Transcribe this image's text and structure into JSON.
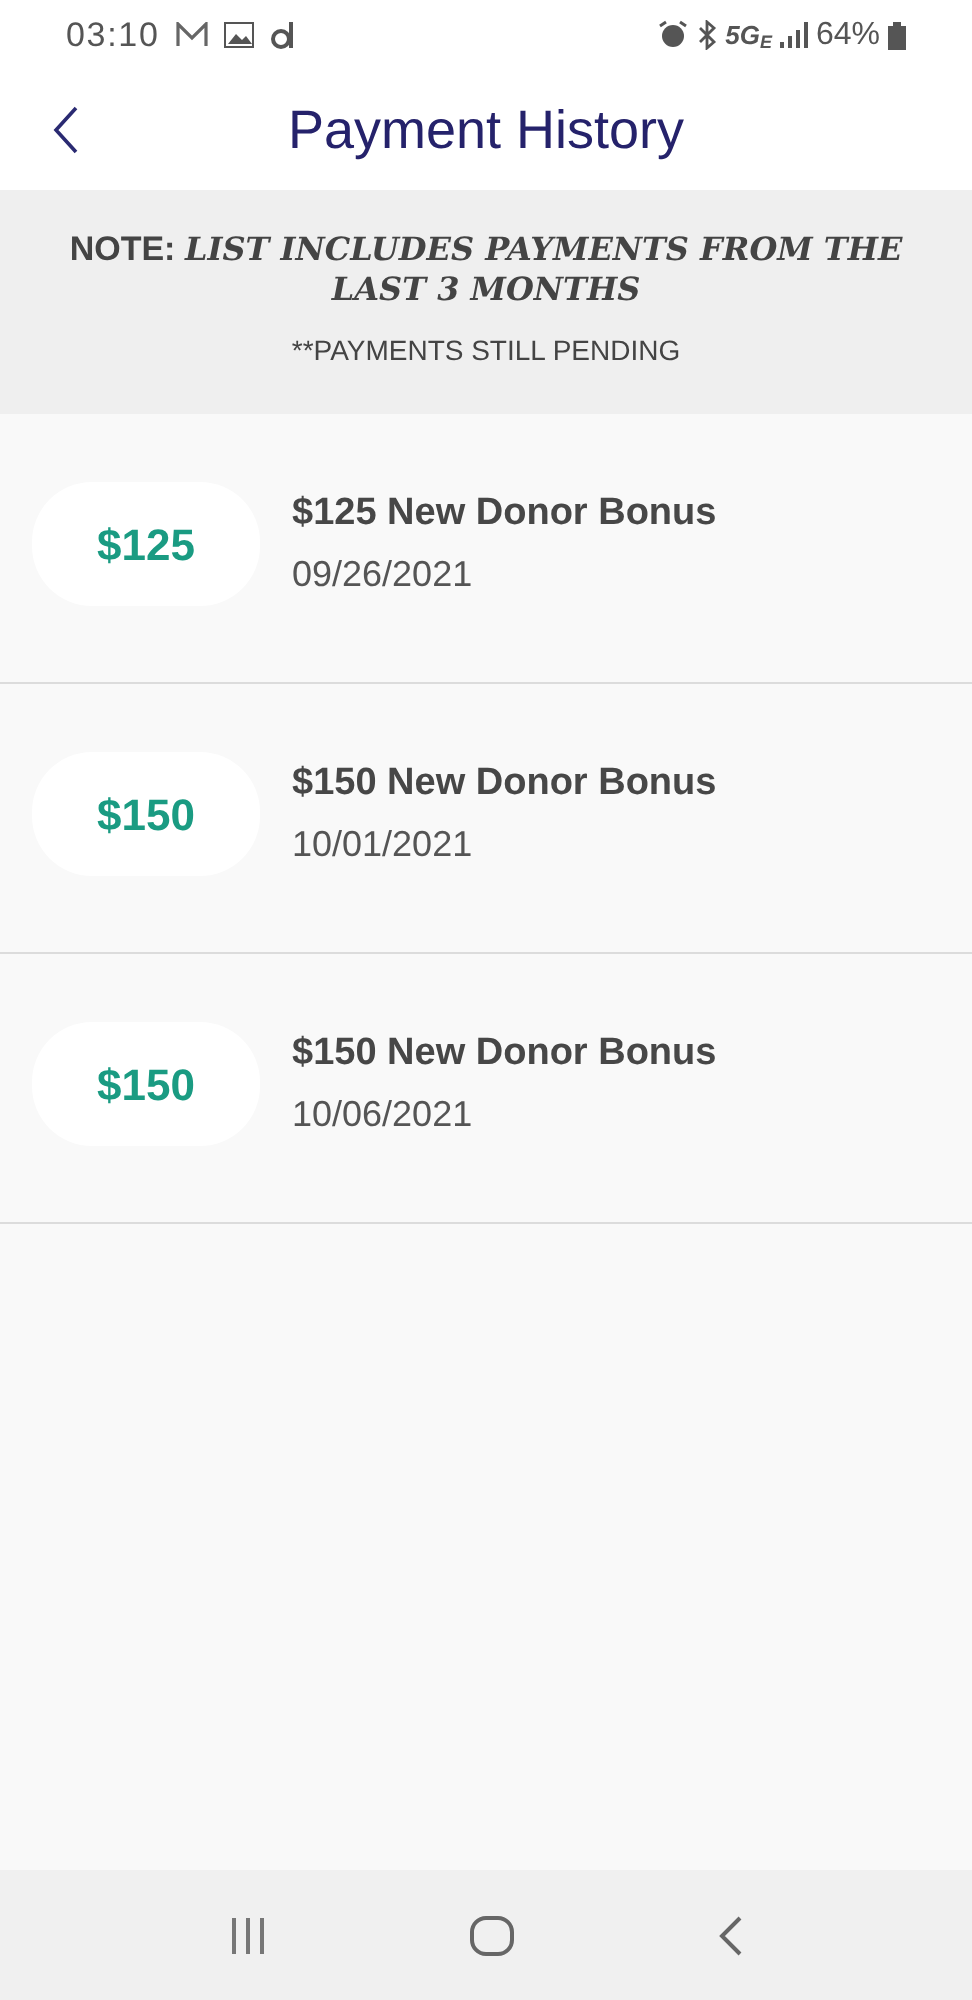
{
  "status_bar": {
    "time": "03:10",
    "network": "5G",
    "network_suffix": "E",
    "battery": "64%"
  },
  "header": {
    "title": "Payment History"
  },
  "notice": {
    "label": "NOTE:",
    "text": "LIST INCLUDES PAYMENTS FROM THE LAST 3 MONTHS",
    "pending": "**PAYMENTS STILL PENDING"
  },
  "payments": [
    {
      "amount": "$125",
      "title": "$125 New Donor Bonus",
      "date": "09/26/2021"
    },
    {
      "amount": "$150",
      "title": "$150 New Donor Bonus",
      "date": "10/01/2021"
    },
    {
      "amount": "$150",
      "title": "$150 New Donor Bonus",
      "date": "10/06/2021"
    }
  ]
}
